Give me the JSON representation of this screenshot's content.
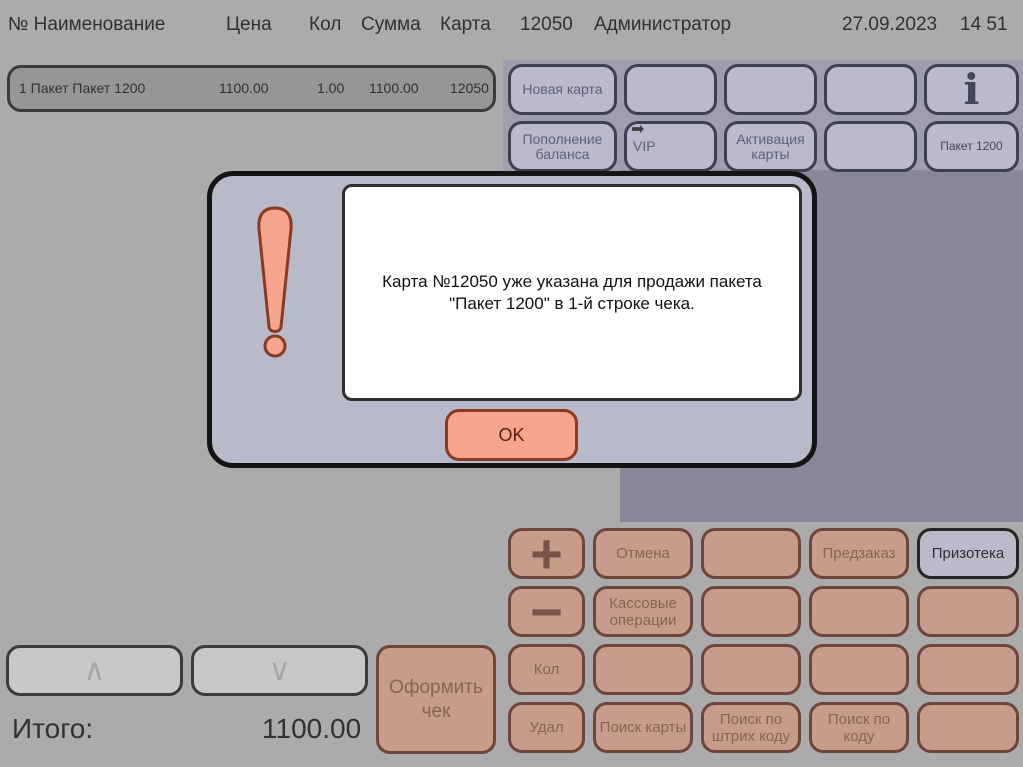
{
  "header": {
    "col_num_name": "№ Наименование",
    "col_price": "Цена",
    "col_qty": "Кол",
    "col_sum": "Сумма",
    "col_card": "Карта",
    "card_number": "12050",
    "user": "Администратор",
    "date": "27.09.2023",
    "time": "14 51"
  },
  "receipt_line": {
    "name": "1 Пакет Пакет 1200",
    "price": "1100.00",
    "qty": "1.00",
    "sum": "1100.00",
    "card": "12050"
  },
  "top_buttons": {
    "new_card": "Новая карта",
    "topup_balance": "Пополнение баланса",
    "vip": "VIP",
    "card_activation": "Активация карты",
    "package_1200": "Пакет 1200",
    "info_icon": "info-icon"
  },
  "action_buttons": {
    "plus": "+",
    "minus": "−",
    "cancel": "Отмена",
    "preorder": "Предзаказ",
    "prize_library": "Призотека",
    "cash_operations": "Кассовые операции",
    "qty": "Кол",
    "delete": "Удал",
    "find_card": "Поиск карты",
    "find_barcode": "Поиск по штрих коду",
    "find_code": "Поиск по коду",
    "checkout": "Оформить чек"
  },
  "footer": {
    "total_label": "Итого:",
    "total_value": "1100.00",
    "scroll_up_icon": "chevron-up-icon",
    "scroll_down_icon": "chevron-down-icon"
  },
  "dialog": {
    "message_line1": "Карта №12050 уже указана для продажи пакета",
    "message_line2": "\"Пакет 1200\" в 1-й строке чека.",
    "ok_label": "OK",
    "icon": "exclamation-icon"
  },
  "colors": {
    "purple_button": "#c8c8dc",
    "orange_button": "#d9a48e",
    "ok_button": "#f6a58d",
    "dialog_bg": "#b9bac9"
  }
}
